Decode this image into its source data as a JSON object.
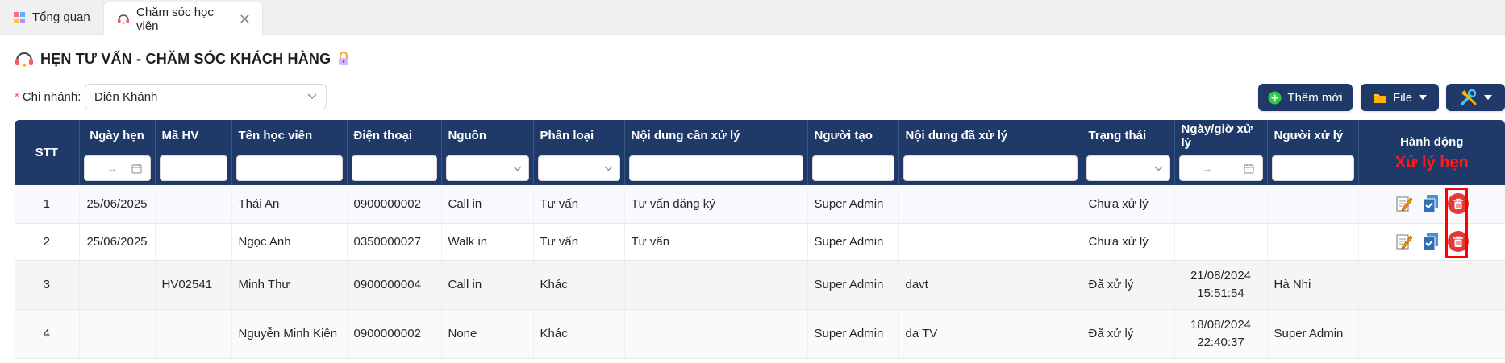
{
  "tabs": [
    {
      "label": "Tổng quan",
      "active": false
    },
    {
      "label": "Chăm sóc học viên",
      "active": true
    }
  ],
  "page": {
    "title": "HẸN TƯ VẤN - CHĂM SÓC KHÁCH HÀNG"
  },
  "filter": {
    "required_mark": "*",
    "branch_label": "Chi nhánh:",
    "branch_value": "Diên Khánh"
  },
  "toolbar": {
    "add_label": "Thêm mới",
    "file_label": "File"
  },
  "table": {
    "headers": {
      "stt": "STT",
      "date": "Ngày hẹn",
      "code": "Mã HV",
      "name": "Tên học viên",
      "phone": "Điện thoại",
      "source": "Nguồn",
      "category": "Phân loại",
      "todo": "Nội dung cần xử lý",
      "creator": "Người tạo",
      "done": "Nội dung đã xử lý",
      "status": "Trạng thái",
      "handled_at": "Ngày/giờ xử lý",
      "handler": "Người xử lý",
      "actions": "Hành động"
    },
    "date_range_arrow": "→",
    "rows": [
      {
        "stt": "1",
        "date": "25/06/2025",
        "code": "",
        "name": "Thái An",
        "phone": "0900000002",
        "source": "Call in",
        "category": "Tư vấn",
        "todo": "Tư vấn đăng ký",
        "creator": "Super Admin",
        "done": "",
        "status": "Chưa xử lý",
        "handled_date": "",
        "handled_time": "",
        "handler": ""
      },
      {
        "stt": "2",
        "date": "25/06/2025",
        "code": "",
        "name": "Ngọc Anh",
        "phone": "0350000027",
        "source": "Walk in",
        "category": "Tư vấn",
        "todo": "Tư vấn",
        "creator": "Super Admin",
        "done": "",
        "status": "Chưa xử lý",
        "handled_date": "",
        "handled_time": "",
        "handler": ""
      },
      {
        "stt": "3",
        "date": "",
        "code": "HV02541",
        "name": "Minh Thư",
        "phone": "0900000004",
        "source": "Call in",
        "category": "Khác",
        "todo": "",
        "creator": "Super Admin",
        "done": "davt",
        "status": "Đã xử lý",
        "handled_date": "21/08/2024",
        "handled_time": "15:51:54",
        "handler": "Hà Nhi"
      },
      {
        "stt": "4",
        "date": "",
        "code": "",
        "name": "Nguyễn Minh Kiên",
        "phone": "0900000002",
        "source": "None",
        "category": "Khác",
        "todo": "",
        "creator": "Super Admin",
        "done": "da TV",
        "status": "Đã xử lý",
        "handled_date": "18/08/2024",
        "handled_time": "22:40:37",
        "handler": "Super Admin"
      }
    ]
  },
  "annotation": {
    "note": "Xử lý hẹn",
    "color": "#ff0000"
  },
  "colors": {
    "header_bg": "#1f3a68",
    "delete": "#e53935",
    "required": "#ff4d4f"
  }
}
